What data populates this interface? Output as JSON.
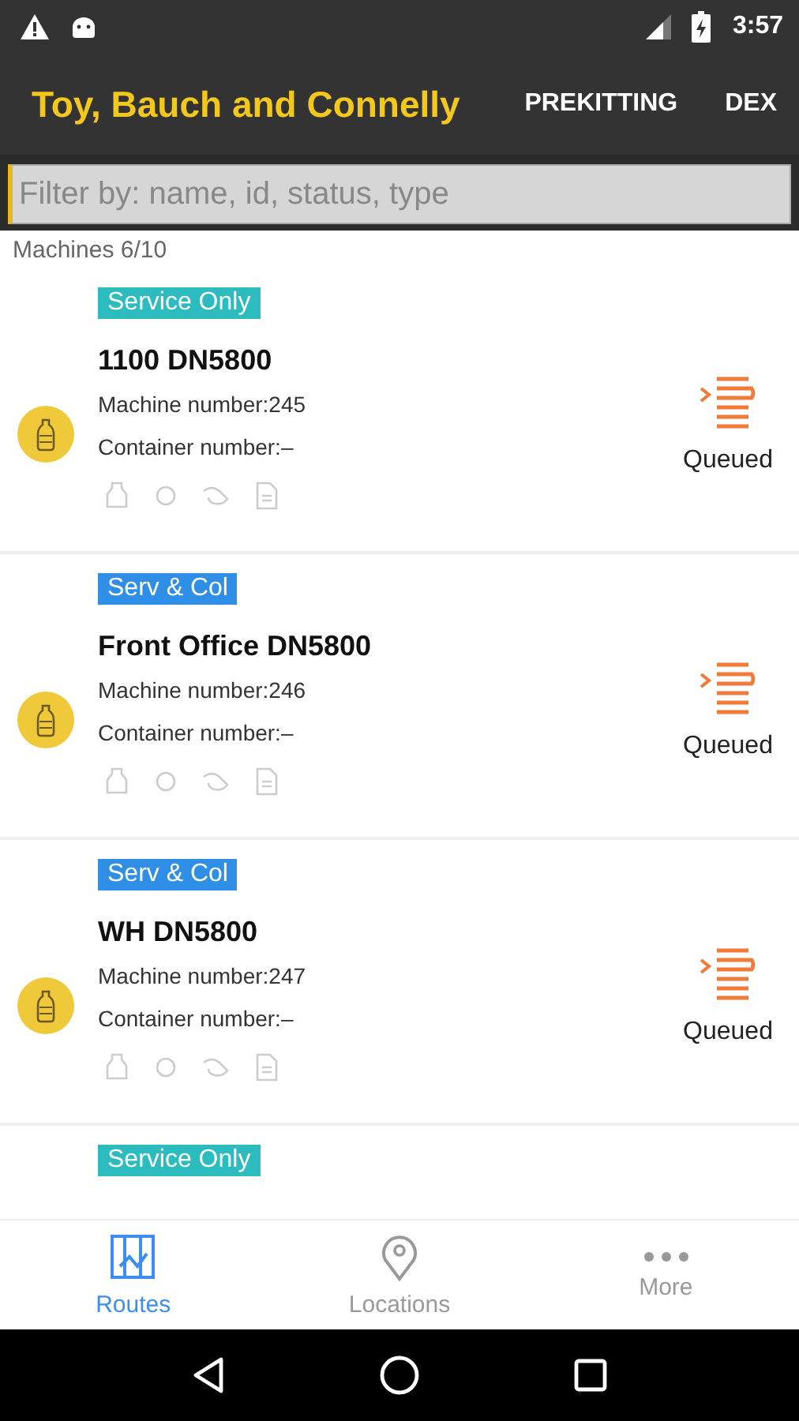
{
  "status_bar": {
    "time": "3:57"
  },
  "app_bar": {
    "title": "Toy, Bauch and Connelly",
    "actions": [
      "PREKITTING",
      "DEX"
    ]
  },
  "filter": {
    "placeholder": "Filter by: name, id, status, type"
  },
  "count": "Machines 6/10",
  "machines": [
    {
      "tag": {
        "label": "Service Only",
        "color": "#2cbcc0"
      },
      "name": "1100 DN5800",
      "machine_number": "Machine number:245",
      "container_number": "Container number:–",
      "status": "Queued"
    },
    {
      "tag": {
        "label": "Serv & Col",
        "color": "#2f8fe6"
      },
      "name": "Front Office DN5800",
      "machine_number": "Machine number:246",
      "container_number": "Container number:–",
      "status": "Queued"
    },
    {
      "tag": {
        "label": "Serv & Col",
        "color": "#2f8fe6"
      },
      "name": "WH DN5800",
      "machine_number": "Machine number:247",
      "container_number": "Container number:–",
      "status": "Queued"
    },
    {
      "tag": {
        "label": "Service Only",
        "color": "#2cbcc0"
      }
    }
  ],
  "bottom_nav": [
    {
      "label": "Routes",
      "kind": "routes",
      "selected": true
    },
    {
      "label": "Locations",
      "kind": "locations",
      "selected": false
    },
    {
      "label": "More",
      "kind": "more",
      "selected": false
    }
  ]
}
